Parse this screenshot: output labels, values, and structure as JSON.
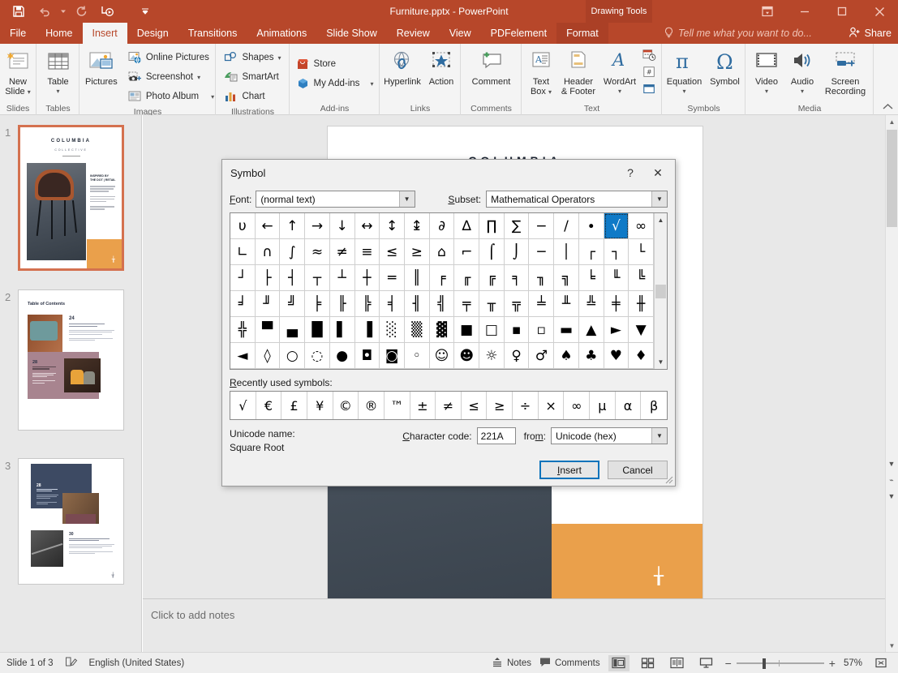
{
  "window": {
    "title": "Furniture.pptx - PowerPoint",
    "contextual_tab_title": "Drawing Tools",
    "quick_access": [
      "save-icon",
      "undo-icon",
      "redo-icon",
      "start-presentation-icon",
      "customize-qat-icon"
    ],
    "controls": [
      "ribbon-display-options-icon",
      "minimize-icon",
      "maximize-icon",
      "close-icon"
    ]
  },
  "tabs": {
    "items": [
      "File",
      "Home",
      "Insert",
      "Design",
      "Transitions",
      "Animations",
      "Slide Show",
      "Review",
      "View",
      "PDFelement",
      "Format"
    ],
    "active": "Insert",
    "contextual": "Format",
    "tellme_placeholder": "Tell me what you want to do...",
    "share_label": "Share"
  },
  "ribbon": {
    "groups": [
      {
        "name": "Slides",
        "buttons": [
          {
            "label": "New",
            "label2": "Slide",
            "icon": "new-slide-icon",
            "dropdown": true
          }
        ]
      },
      {
        "name": "Tables",
        "buttons": [
          {
            "label": "Table",
            "label2": "",
            "icon": "table-icon",
            "dropdown": true
          }
        ]
      },
      {
        "name": "Images",
        "buttons": [
          {
            "label": "Pictures",
            "label2": "",
            "icon": "pictures-icon",
            "dropdown": false
          }
        ],
        "small": [
          {
            "label": "Online Pictures",
            "icon": "online-pictures-icon",
            "dropdown": false
          },
          {
            "label": "Screenshot",
            "icon": "screenshot-icon",
            "dropdown": true
          },
          {
            "label": "Photo Album",
            "icon": "photo-album-icon",
            "dropdown": true
          }
        ]
      },
      {
        "name": "Illustrations",
        "small": [
          {
            "label": "Shapes",
            "icon": "shapes-icon",
            "dropdown": true
          },
          {
            "label": "SmartArt",
            "icon": "smartart-icon",
            "dropdown": false
          },
          {
            "label": "Chart",
            "icon": "chart-icon",
            "dropdown": false
          }
        ]
      },
      {
        "name": "Add-ins",
        "small": [
          {
            "label": "Store",
            "icon": "store-icon",
            "dropdown": false
          },
          {
            "label": "My Add-ins",
            "icon": "my-addins-icon",
            "dropdown": true
          }
        ]
      },
      {
        "name": "Links",
        "buttons": [
          {
            "label": "Hyperlink",
            "label2": "",
            "icon": "hyperlink-icon",
            "dropdown": false
          },
          {
            "label": "Action",
            "label2": "",
            "icon": "action-icon",
            "dropdown": false
          }
        ]
      },
      {
        "name": "Comments",
        "buttons": [
          {
            "label": "Comment",
            "label2": "",
            "icon": "comment-icon",
            "dropdown": false
          }
        ]
      },
      {
        "name": "Text",
        "buttons": [
          {
            "label": "Text",
            "label2": "Box",
            "icon": "text-box-icon",
            "dropdown": true
          },
          {
            "label": "Header",
            "label2": "& Footer",
            "icon": "header-footer-icon",
            "dropdown": false
          },
          {
            "label": "WordArt",
            "label2": "",
            "icon": "wordart-icon",
            "dropdown": true
          }
        ],
        "stack": [
          "date-time-icon",
          "slide-number-icon",
          "object-icon"
        ]
      },
      {
        "name": "Symbols",
        "buttons": [
          {
            "label": "Equation",
            "label2": "",
            "icon": "equation-icon",
            "dropdown": true
          },
          {
            "label": "Symbol",
            "label2": "",
            "icon": "symbol-icon",
            "dropdown": false
          }
        ]
      },
      {
        "name": "Media",
        "buttons": [
          {
            "label": "Video",
            "label2": "",
            "icon": "video-icon",
            "dropdown": true
          },
          {
            "label": "Audio",
            "label2": "",
            "icon": "audio-icon",
            "dropdown": true
          },
          {
            "label": "Screen",
            "label2": "Recording",
            "icon": "screen-recording-icon",
            "dropdown": false
          }
        ]
      }
    ]
  },
  "slides_panel": {
    "slides": [
      {
        "number": "1",
        "selected": true,
        "title": "COLUMBIA",
        "subtitle": "COLLECTIVE"
      },
      {
        "number": "2",
        "selected": false,
        "title": "Table of Contents",
        "subtitle": ""
      },
      {
        "number": "3",
        "selected": false,
        "title": "",
        "subtitle": ""
      }
    ]
  },
  "slide": {
    "title": "COLUMBIA",
    "subtitle": "COLLECTIVE",
    "mark": "╁"
  },
  "notes": {
    "placeholder": "Click to add notes"
  },
  "status": {
    "slide_counter": "Slide 1 of 3",
    "language": "English (United States)",
    "notes_label": "Notes",
    "comments_label": "Comments",
    "zoom_level": "57%",
    "views": [
      "normal-view-icon",
      "slide-sorter-icon",
      "reading-view-icon",
      "slide-show-icon"
    ],
    "fit_icon": "fit-slide-to-window-icon"
  },
  "dialog": {
    "title": "Symbol",
    "help_label": "?",
    "close_label": "✕",
    "font_label": "Font:",
    "font_label_mnemonic": "F",
    "font_value": "(normal text)",
    "subset_label": "Subset:",
    "subset_label_mnemonic": "S",
    "subset_value": "Mathematical Operators",
    "recent_label": "Recently used symbols:",
    "unicode_name_label": "Unicode name:",
    "unicode_name_value": "Square Root",
    "char_code_label": "Character code:",
    "char_code_value": "221A",
    "from_label": "from:",
    "from_value": "Unicode (hex)",
    "insert_label": "Insert",
    "cancel_label": "Cancel",
    "selected_symbol": "√",
    "grid": [
      [
        "υ",
        "←",
        "↑",
        "→",
        "↓",
        "↔",
        "↕",
        "↨",
        "∂",
        "∆",
        "∏",
        "∑",
        "−",
        "∕",
        "∙",
        "√",
        "∞"
      ],
      [
        "∟",
        "∩",
        "∫",
        "≈",
        "≠",
        "≡",
        "≤",
        "≥",
        "⌂",
        "⌐",
        "⌠",
        "⌡",
        "─",
        "│",
        "┌",
        "┐",
        "└"
      ],
      [
        "┘",
        "├",
        "┤",
        "┬",
        "┴",
        "┼",
        "═",
        "║",
        "╒",
        "╓",
        "╔",
        "╕",
        "╖",
        "╗",
        "╘",
        "╙",
        "╚"
      ],
      [
        "╛",
        "╜",
        "╝",
        "╞",
        "╟",
        "╠",
        "╡",
        "╢",
        "╣",
        "╤",
        "╥",
        "╦",
        "╧",
        "╨",
        "╩",
        "╪",
        "╫"
      ],
      [
        "╬",
        "▀",
        "▄",
        "█",
        "▌",
        "▐",
        "░",
        "▒",
        "▓",
        "■",
        "□",
        "▪",
        "▫",
        "▬",
        "▲",
        "►",
        "▼"
      ],
      [
        "◄",
        "◊",
        "○",
        "◌",
        "●",
        "◘",
        "◙",
        "◦",
        "☺",
        "☻",
        "☼",
        "♀",
        "♂",
        "♠",
        "♣",
        "♥",
        "♦"
      ]
    ],
    "selected_cell": {
      "row": 0,
      "col": 15
    },
    "recent": [
      "√",
      "€",
      "£",
      "¥",
      "©",
      "®",
      "™",
      "±",
      "≠",
      "≤",
      "≥",
      "÷",
      "×",
      "∞",
      "µ",
      "α",
      "β"
    ]
  },
  "colors": {
    "brand": "#b7472a",
    "accent_selection": "#0f7ac7",
    "slide_orange": "#eaa04b",
    "thumb_selected_border": "#d4714f"
  }
}
